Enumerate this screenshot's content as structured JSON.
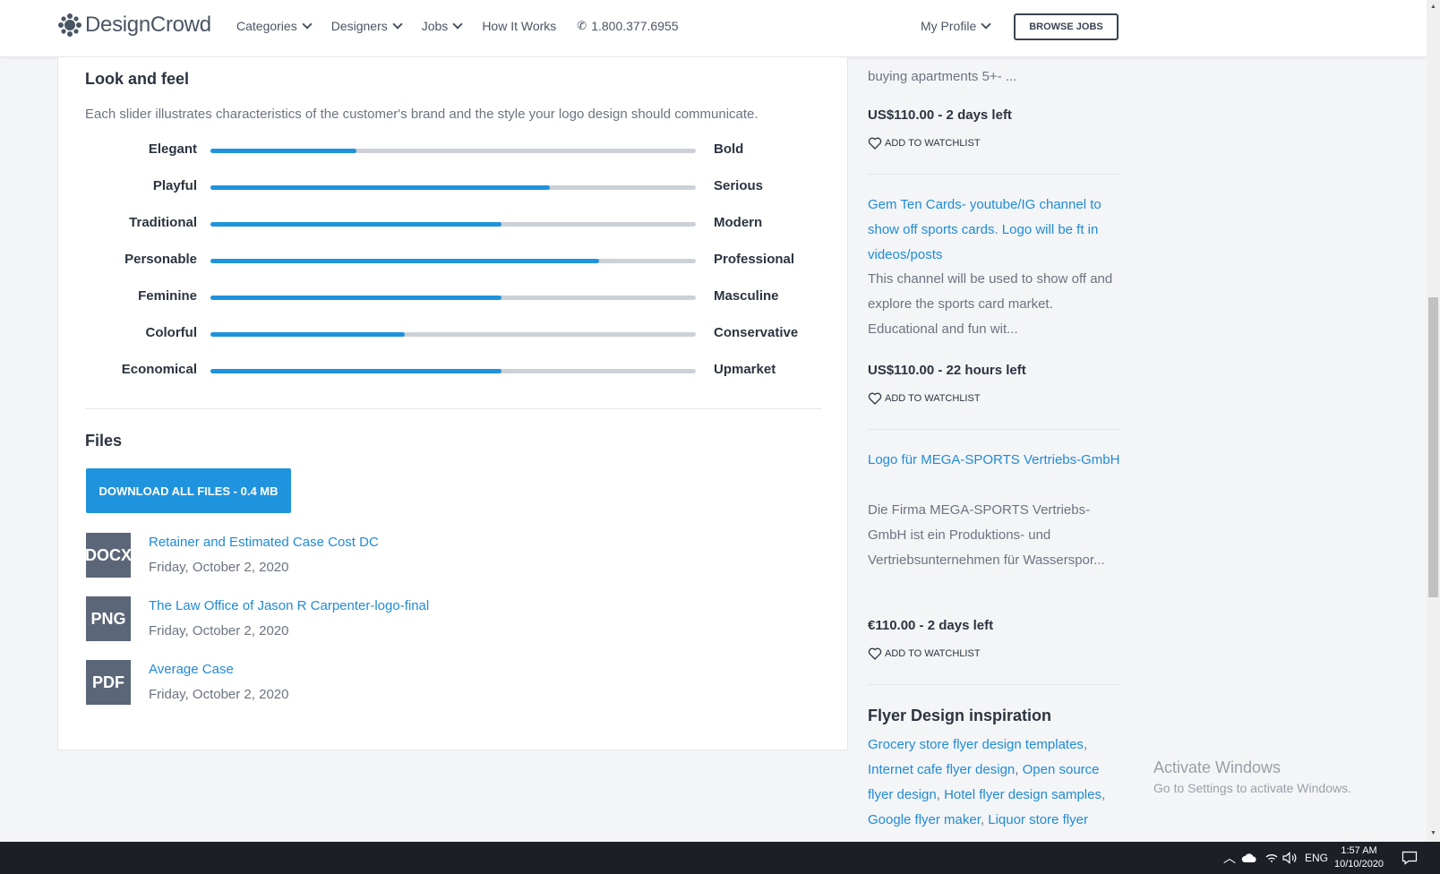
{
  "header": {
    "brand": "DesignCrowd",
    "nav": [
      "Categories",
      "Designers",
      "Jobs",
      "How It Works"
    ],
    "phone": "1.800.377.6955",
    "profile": "My Profile",
    "browse_jobs": "BROWSE JOBS"
  },
  "look_and_feel": {
    "title": "Look and feel",
    "description": "Each slider illustrates characteristics of the customer's brand and the style your logo design should communicate.",
    "sliders": [
      {
        "left": "Elegant",
        "right": "Bold",
        "value": 0.3
      },
      {
        "left": "Playful",
        "right": "Serious",
        "value": 0.7
      },
      {
        "left": "Traditional",
        "right": "Modern",
        "value": 0.6
      },
      {
        "left": "Personable",
        "right": "Professional",
        "value": 0.8
      },
      {
        "left": "Feminine",
        "right": "Masculine",
        "value": 0.6
      },
      {
        "left": "Colorful",
        "right": "Conservative",
        "value": 0.4
      },
      {
        "left": "Economical",
        "right": "Upmarket",
        "value": 0.6
      }
    ]
  },
  "files": {
    "title": "Files",
    "download_all": "DOWNLOAD ALL FILES - 0.4 MB",
    "items": [
      {
        "type": "DOCX",
        "name": "Retainer and Estimated Case Cost DC",
        "date": "Friday, October 2, 2020"
      },
      {
        "type": "PNG",
        "name": "The Law Office of Jason R Carpenter-logo-final",
        "date": "Friday, October 2, 2020"
      },
      {
        "type": "PDF",
        "name": "Average Case",
        "date": "Friday, October 2, 2020"
      }
    ]
  },
  "sidebar": {
    "job1": {
      "desc_tail": "buying apartments 5+- ...",
      "price": "US$110.00 - 2 days left",
      "watch": "ADD TO WATCHLIST"
    },
    "job2": {
      "title": "Gem Ten Cards- youtube/IG channel to show off sports cards. Logo will be ft in videos/posts",
      "desc": "This channel will be used to show off and explore the sports card market. Educational and fun wit...",
      "price": "US$110.00 - 22 hours left",
      "watch": "ADD TO WATCHLIST"
    },
    "job3": {
      "title": "Logo für MEGA-SPORTS Vertriebs-GmbH",
      "desc": "Die Firma MEGA-SPORTS Vertriebs-GmbH ist ein Produktions- und Vertriebsunternehmen für Wasserspor...",
      "price": "€110.00 - 2 days left",
      "watch": "ADD TO WATCHLIST"
    },
    "inspiration": {
      "title": "Flyer Design inspiration",
      "links": [
        "Grocery store flyer design templates",
        "Internet cafe flyer design",
        "Open source flyer design",
        "Hotel flyer design samples",
        "Google flyer maker",
        "Liquor store flyer"
      ]
    }
  },
  "watermark": {
    "line1": "Activate Windows",
    "line2": "Go to Settings to activate Windows."
  },
  "taskbar": {
    "lang": "ENG",
    "time": "1:57 AM",
    "date": "10/10/2020"
  },
  "colors": {
    "accent": "#1f93dd",
    "link": "#1f8bd6",
    "file_icon": "#5b6678"
  }
}
